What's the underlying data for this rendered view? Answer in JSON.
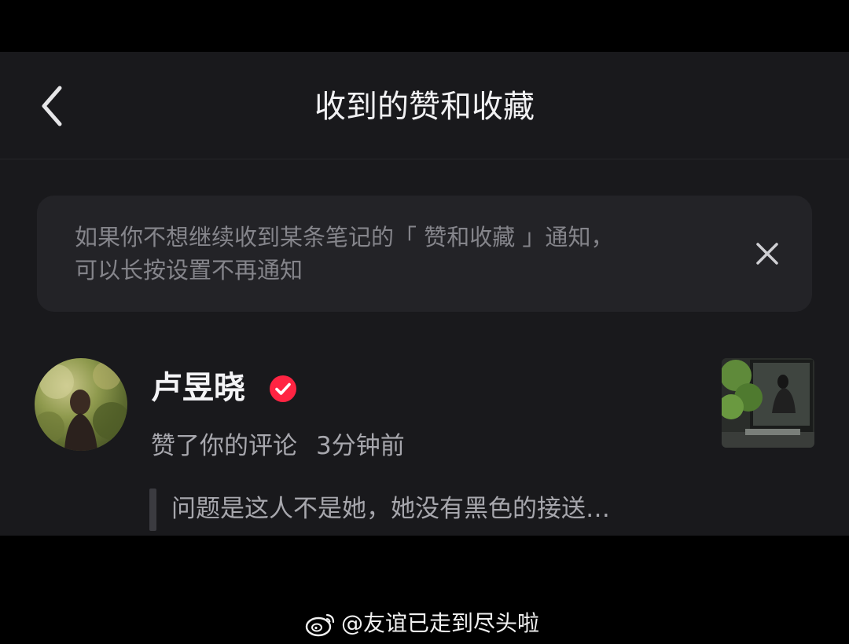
{
  "header": {
    "title": "收到的赞和收藏",
    "back_icon": "chevron-left-icon"
  },
  "notice": {
    "line1": "如果你不想继续收到某条笔记的「 赞和收藏 」通知，",
    "line2": "可以长按设置不再通知",
    "close_icon": "close-icon"
  },
  "notification": {
    "user_name": "卢昱晓",
    "verified_icon": "verified-badge-icon",
    "action": "赞了你的评论",
    "time": "3分钟前",
    "comment": "问题是这人不是她，她没有黑色的接送…"
  },
  "watermark": {
    "text": "@友谊已走到尽头啦",
    "logo": "weibo-logo-icon"
  },
  "colors": {
    "background": "#19191c",
    "notice_bg": "#232327",
    "verified_red": "#ff2442",
    "text_primary": "#f1f1f3",
    "text_secondary": "#a7a7ad"
  }
}
